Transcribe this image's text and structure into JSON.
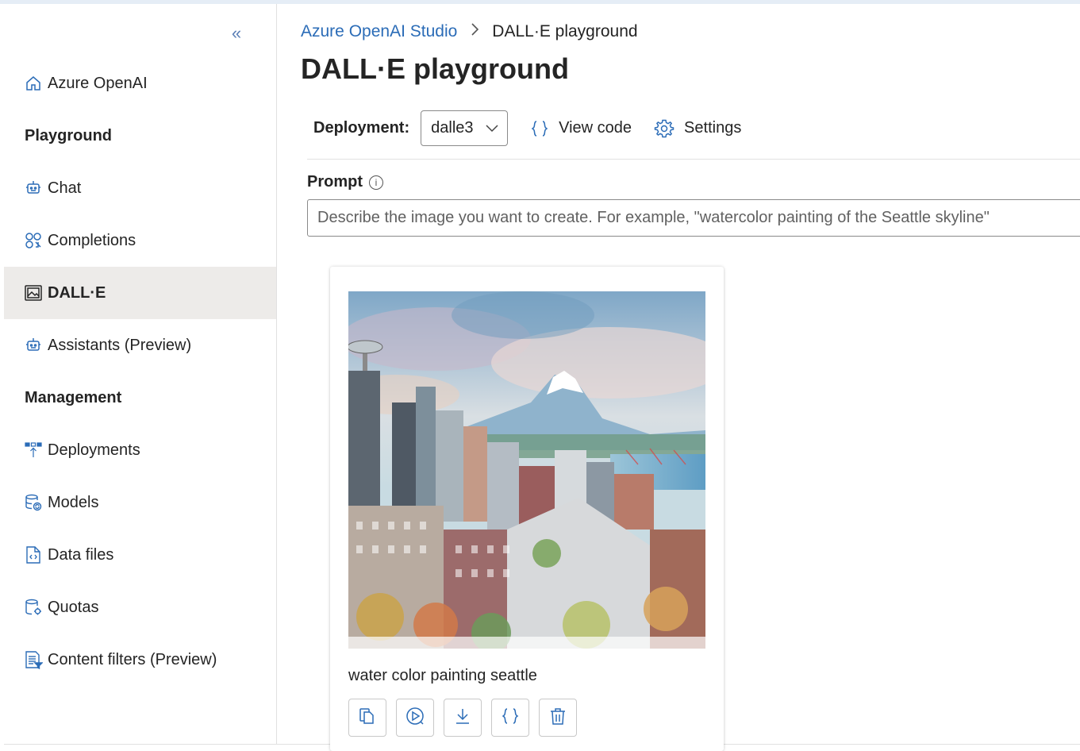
{
  "sidebar": {
    "collapse_icon": "double-chevron-left-icon",
    "home": {
      "label": "Azure OpenAI",
      "icon": "home-icon"
    },
    "sections": [
      {
        "title": "Playground",
        "items": [
          {
            "label": "Chat",
            "icon": "bot-icon"
          },
          {
            "label": "Completions",
            "icon": "completions-icon"
          },
          {
            "label": "DALL·E",
            "icon": "image-icon",
            "active": true
          },
          {
            "label": "Assistants (Preview)",
            "icon": "bot-icon"
          }
        ]
      },
      {
        "title": "Management",
        "items": [
          {
            "label": "Deployments",
            "icon": "deployments-icon"
          },
          {
            "label": "Models",
            "icon": "models-icon"
          },
          {
            "label": "Data files",
            "icon": "data-file-icon"
          },
          {
            "label": "Quotas",
            "icon": "quotas-icon"
          },
          {
            "label": "Content filters (Preview)",
            "icon": "content-filter-icon"
          }
        ]
      }
    ]
  },
  "breadcrumb": {
    "root": "Azure OpenAI Studio",
    "current": "DALL·E playground"
  },
  "page": {
    "title": "DALL·E playground"
  },
  "toolbar": {
    "deployment_label": "Deployment:",
    "deployment_value": "dalle3",
    "view_code_label": "View code",
    "settings_label": "Settings"
  },
  "prompt": {
    "label": "Prompt",
    "value": "",
    "placeholder": "Describe the image you want to create. For example, \"watercolor painting of the Seattle skyline\""
  },
  "result": {
    "caption": "water color painting seattle",
    "actions": [
      "copy-icon",
      "variation-icon",
      "download-icon",
      "code-icon",
      "delete-icon"
    ]
  },
  "colors": {
    "accent": "#2b6cb7",
    "active_bg": "#edebe9",
    "text": "#242424"
  }
}
